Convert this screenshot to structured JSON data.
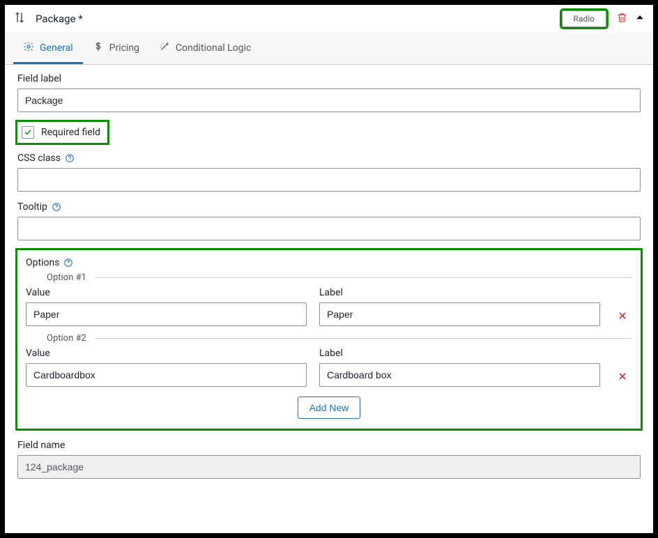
{
  "header": {
    "title": "Package *",
    "badge": "Radio"
  },
  "tabs": {
    "general": "General",
    "pricing": "Pricing",
    "conditional": "Conditional Logic"
  },
  "general": {
    "field_label_label": "Field label",
    "field_label_value": "Package",
    "required_label": "Required field",
    "required_checked": true,
    "css_class_label": "CSS class",
    "css_class_value": "",
    "tooltip_label": "Tooltip",
    "tooltip_value": "",
    "field_name_label": "Field name",
    "field_name_value": "124_package"
  },
  "options_section": {
    "title": "Options",
    "value_label": "Value",
    "label_label": "Label",
    "add_new": "Add New",
    "options": [
      {
        "legend": "Option #1",
        "value": "Paper",
        "label": "Paper"
      },
      {
        "legend": "Option #2",
        "value": "Cardboardbox",
        "label": "Cardboard box"
      }
    ]
  }
}
